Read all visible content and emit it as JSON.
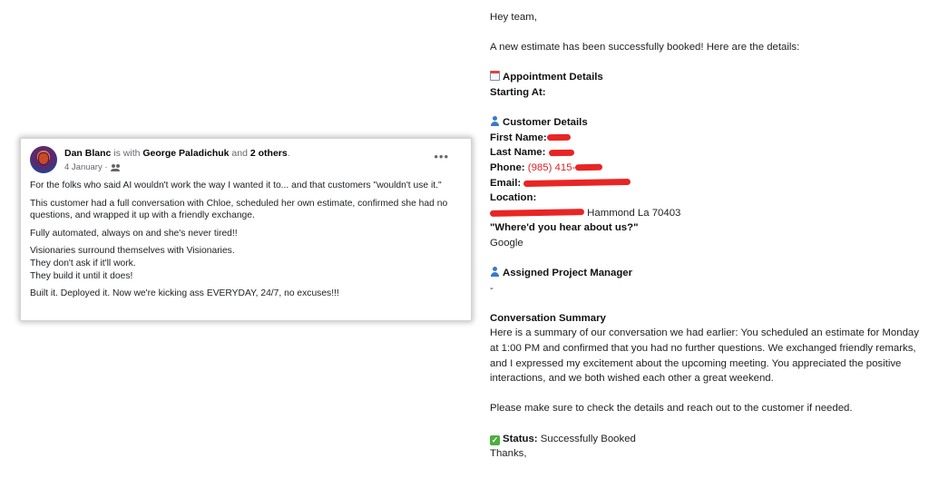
{
  "post": {
    "author": "Dan Blanc",
    "with_text": " is with ",
    "tagged": "George Paladichuk",
    "and_text": " and ",
    "others": "2 others",
    "period": ".",
    "date": "4 January ·",
    "more_icon": "more-horizontal-icon",
    "paragraphs": [
      "For the folks who said AI wouldn't work the way I wanted it to... and that customers \"wouldn't use it.\"",
      "This customer had a full conversation with Chloe, scheduled her own estimate, confirmed she had no questions, and wrapped it up with a friendly exchange.",
      "Fully automated, always on and she's never tired!!",
      "Visionaries surround themselves with Visionaries.",
      "They don't ask if it'll work.",
      "They build it until it does!",
      "Built it. Deployed it. Now we're kicking ass EVERYDAY, 24/7, no excuses!!!"
    ]
  },
  "email": {
    "greeting": "Hey team,",
    "intro": "A new estimate has been successfully booked! Here are the details:",
    "appointment_heading": "Appointment Details",
    "starting_at_label": "Starting At:",
    "customer_heading": "Customer Details",
    "first_name_label": "First Name:",
    "last_name_label": "Last Name:",
    "phone_label": "Phone:",
    "phone_value": "(985) 415-",
    "email_label": "Email:",
    "location_label": "Location:",
    "location_value": "Hammond La 70403",
    "source_question": "\"Where'd you hear about us?\"",
    "source_answer": "Google",
    "pm_heading": "Assigned Project Manager",
    "pm_value": "-",
    "summary_heading": "Conversation Summary",
    "summary_text": "Here is a summary of our conversation we had earlier: You scheduled an estimate for Monday at 1:00 PM and confirmed that you had no further questions. We exchanged friendly remarks, and I expressed my excitement about the upcoming meeting. You appreciated the positive interactions, and we both wished each other a great weekend.",
    "closing_note": "Please make sure to check the details and reach out to the customer if needed.",
    "status_label": "Status:",
    "status_value": "Successfully Booked",
    "signoff": "Thanks,"
  },
  "colors": {
    "redaction": "#e82525",
    "phone_text": "#dd2222",
    "status_check": "#4caf3e"
  }
}
